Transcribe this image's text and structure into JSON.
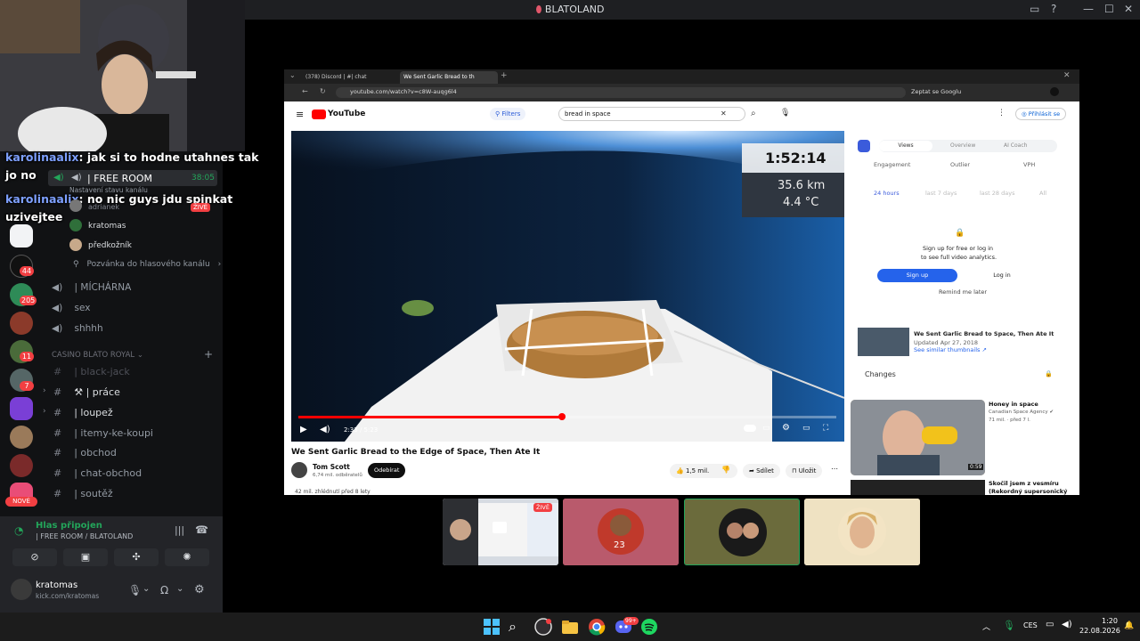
{
  "app": {
    "title": "BLATOLAND"
  },
  "chat_overlay": [
    {
      "user": "karolinaalix",
      "text": ": jak si to hodne utahnes tak"
    },
    {
      "user": "",
      "text": "jo no"
    },
    {
      "user": "karolinaalix",
      "text": ": no nic guys jdu spinkat"
    },
    {
      "user": "",
      "text": "uzivejtee"
    }
  ],
  "servers": {
    "badges": [
      "44",
      "205",
      "11",
      "7"
    ],
    "new_label": "NOVÉ"
  },
  "voice_channel": {
    "name": "| FREE ROOM",
    "timer": "38:05",
    "status_hint": "Nastavení stavu kanálu",
    "live_badge": "ŽIVĚ",
    "members": [
      "adrianek",
      "kratomas",
      "předkožník"
    ],
    "invite": "Pozvánka do hlasového kanálu"
  },
  "channels": {
    "voice": [
      "| MÍCHÁRNA",
      "sex",
      "shhhh"
    ],
    "category": "CASINO BLATO ROYAL",
    "text": [
      {
        "label": "| black-jack",
        "muted": true
      },
      {
        "label": "⚒ | práce",
        "muted": false
      },
      {
        "label": "| loupež",
        "muted": false
      },
      {
        "label": "| itemy-ke-koupi",
        "muted": false
      },
      {
        "label": "| obchod",
        "muted": false
      },
      {
        "label": "| chat-obchod",
        "muted": false
      },
      {
        "label": "| soutěž",
        "muted": false
      }
    ]
  },
  "voice_panel": {
    "status": "Hlas připojen",
    "location": "| FREE ROOM / BLATOLAND",
    "username": "kratomas",
    "subtext": "kick.com/kratomas"
  },
  "stream": {
    "live_badge": "ŽIVĚ",
    "tabs": [
      "(378) Discord | #| chat",
      "We Sent Garlic Bread to th"
    ],
    "url": "youtube.com/watch?v=c8W-auqg6l4",
    "address_right": "Zeptat se Googlu",
    "yt": {
      "logo": "YouTube",
      "filters": "Filters",
      "search_query": "bread in space",
      "sign_in": "Přihlásit se",
      "video_title": "We Sent Garlic Bread to the Edge of Space, Then Ate It",
      "channel": "Tom Scott",
      "subs": "6,74 mil. odběratelů",
      "subscribe": "Odebírat",
      "likes": "1,5 mil.",
      "share": "Sdílet",
      "save": "Uložit",
      "time": "2:33 / 5:23",
      "progress": 0.49,
      "views_line": "42 mil. zhlédnutí  před 8 lety",
      "overlay_time": "1:52:14",
      "overlay_alt": "35.6 km",
      "overlay_temp": "4.4 °C"
    },
    "analytics": {
      "tabs": [
        "Views",
        "Overview",
        "AI Coach"
      ],
      "metrics": [
        "Engagement",
        "Outlier",
        "VPH"
      ],
      "ranges": [
        "24 hours",
        "last 7 days",
        "last 28 days",
        "All"
      ],
      "signup_line1": "Sign up for free or log in",
      "signup_line2": "to see full video analytics.",
      "signup_btn": "Sign up",
      "login_btn": "Log in",
      "remind": "Remind me later",
      "thumb_title": "We Sent Garlic Bread to Space, Then Ate It",
      "thumb_date": "Updated Apr 27, 2018",
      "thumb_link": "See similar thumbnails ↗",
      "changes": "Changes"
    },
    "related": [
      {
        "title": "Honey in space",
        "channel": "Canadian Space Agency ✔",
        "meta": "71 mil. · před 7 l.",
        "dur": "0:59"
      },
      {
        "title": "Skočil jsem z vesmíru (Rekordný supersonický",
        "channel": "",
        "meta": "",
        "dur": ""
      }
    ]
  },
  "taskbar": {
    "lang": "CES",
    "time": "1:20",
    "date": "22.08.2026",
    "discord_badge": "99+"
  }
}
